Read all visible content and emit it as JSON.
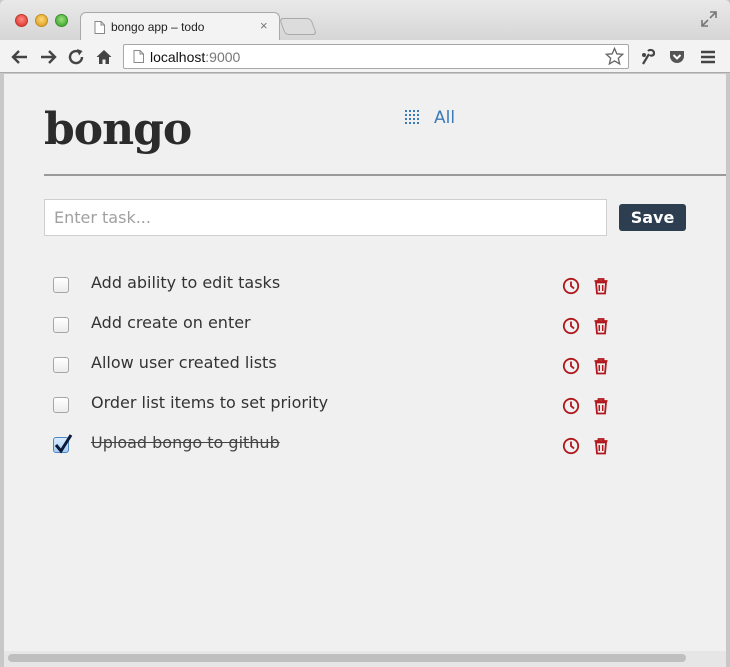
{
  "browser": {
    "tab_title": "bongo app – todo",
    "tab_close": "×",
    "url_host": "localhost",
    "url_port": ":9000"
  },
  "app": {
    "logo": "bongo",
    "nav_all_label": "All",
    "task_input": {
      "placeholder": "Enter task...",
      "value": ""
    },
    "save_label": "Save",
    "accent_color": "#2c3e50",
    "action_icon_color": "#b0171c",
    "link_color": "#3a7ab8",
    "tasks": [
      {
        "text": "Add ability to edit tasks",
        "done": false
      },
      {
        "text": "Add create on enter",
        "done": false
      },
      {
        "text": "Allow user created lists",
        "done": false
      },
      {
        "text": "Order list items to set priority",
        "done": false
      },
      {
        "text": "Upload bongo to github",
        "done": true
      }
    ]
  }
}
